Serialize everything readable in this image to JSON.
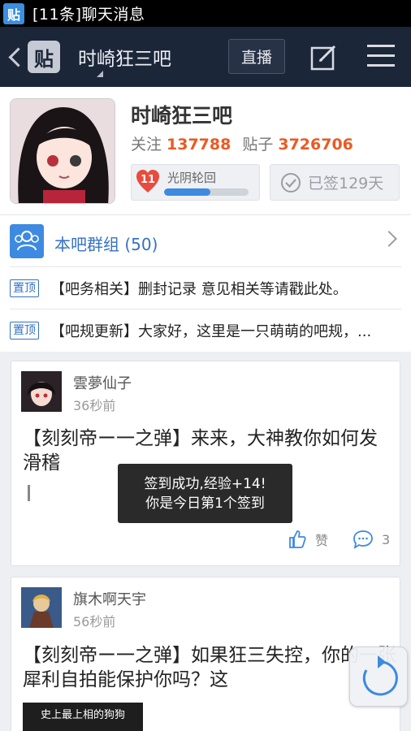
{
  "status_bar": {
    "app_icon_glyph": "贴",
    "notification": "[11条]聊天消息"
  },
  "nav": {
    "logo_glyph": "贴",
    "title": "时崎狂三吧",
    "live_button": "直播"
  },
  "forum": {
    "name": "时崎狂三吧",
    "follow_label": "关注",
    "follow_count": "137788",
    "posts_label": "贴子",
    "posts_count": "3726706",
    "level_number": "11",
    "level_name": "光阴轮回",
    "level_progress": 0.55,
    "signed_text": "已签129天"
  },
  "group": {
    "label": "本吧群组 (50)"
  },
  "pinned": [
    {
      "tag": "置顶",
      "text": "【吧务相关】删封记录 意见相关等请戳此处。"
    },
    {
      "tag": "置顶",
      "text": "【吧规更新】大家好，这里是一只萌萌的吧规，..."
    }
  ],
  "posts": [
    {
      "author": "雲夢仙子",
      "time": "36秒前",
      "title": "【刻刻帝ー一之弹】来来，大神教你如何发滑稽",
      "like_label": "赞",
      "comment_count": "3"
    },
    {
      "author": "旗木啊天宇",
      "time": "56秒前",
      "title": "【刻刻帝ー一之弹】如果狂三失控，你的一张犀利自拍能保护你吗？这",
      "image_caption": "史上最上相的狗狗"
    }
  ],
  "toast": {
    "line1": "签到成功,经验+14!",
    "line2": "你是今日第1个签到"
  },
  "colors": {
    "accent_blue": "#3d8ae0",
    "stat_orange": "#ea5a23",
    "navbar": "#1c2639"
  }
}
